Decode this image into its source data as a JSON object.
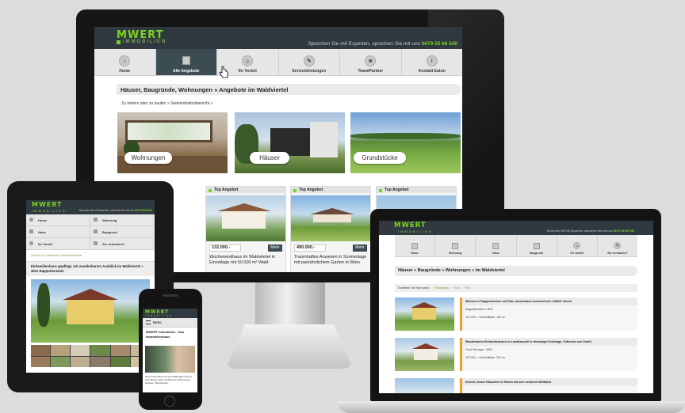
{
  "desktop": {
    "logo": "MWERT",
    "logo_sub": "IMMOBILIEN",
    "tagline_text": "Sprechen Sie mit Experten, sprechen Sie mit uns",
    "phone": "0679 55 66 540",
    "nav": [
      {
        "label": "Home",
        "icon": "home-icon"
      },
      {
        "label": "Alle Angebote",
        "icon": "building-icon",
        "active": true
      },
      {
        "label": "Ihr Vorteil",
        "icon": "smiley-icon"
      },
      {
        "label": "Serviceleistungen",
        "icon": "wrench-icon"
      },
      {
        "label": "Team/Partner",
        "icon": "person-icon"
      },
      {
        "label": "Kontakt Eaton",
        "icon": "info-icon"
      }
    ],
    "page_title": "Häuser, Baugründe, Wohnungen » Angebote im Waldviertel",
    "breadcrumb": "Zu mieten oder zu kaufen » Seiteninhaltsübersicht »",
    "categories": [
      "Wohnungen",
      "Häuser",
      "Grundstücke"
    ],
    "offers": [
      {
        "badge": "Top Angebot",
        "price": "132.000.-",
        "more": "Mehr",
        "text": "Wochenendhaus im Waldviertel in Einzellage mit 50.000 m² Wald"
      },
      {
        "badge": "Top Angebot",
        "price": "490.000.-",
        "more": "Mehr",
        "text": "Traumhaftes Anwesen in Sonnenlage mit parkähnlichem Garten in Wien"
      },
      {
        "badge": "Top Angebot",
        "price": "",
        "more": "",
        "text": ""
      }
    ]
  },
  "tablet": {
    "logo": "MWERT",
    "logo_sub": "IMMOBILIEN",
    "tagline_text": "Sprechen Sie mit Experten, sprechen Sie mit uns",
    "phone": "0679 55 66 540",
    "menu": [
      "Home",
      "Wohnung",
      "Haus",
      "Baugrund",
      "Ihr Vorteil",
      "Sie verkaufen?"
    ],
    "crumbs": [
      "Zurück zur Übersicht",
      "Wohnimmobilie"
    ],
    "title": "Einfamilienhaus gepflegt, mit wunderbarem Ausblick im Waldviertel » 3911 Rappottenstein"
  },
  "phone": {
    "logo": "MWERT",
    "logo_sub": "IMMOBILIEN",
    "menu_label": "Menü",
    "title": "MWERT Immobilien - Das Immobilienhaus",
    "text": "Das Unternehmen ist seit 2006 tätig und auf Vermittlung sowie Verkauf von Wohnungen, Häusern, Baugründen"
  },
  "laptop": {
    "logo": "MWERT",
    "logo_sub": "IMMOBILIEN",
    "tagline_text": "Sprechen Sie mit Experten, sprechen Sie mit uns",
    "phone": "0679 55 66 540",
    "nav": [
      "Home",
      "Wohnung",
      "Haus",
      "Baugrund",
      "Ihr Vorteil",
      "Sie verkaufen?"
    ],
    "title": "Häuser » Baugründe » Wohnungen » im Waldviertel",
    "sort_label": "Sortieren Sie hier nach:",
    "sort_options": [
      "Kaufpreis",
      "Ort",
      "Plz"
    ],
    "listings": [
      {
        "title": "Wohnen in Rappottenstein mit Flair, wunderbarer Aussicht und 1.580m² Grund",
        "place": "Rappottenstein",
        "plz": "3911",
        "price": "147.900.-",
        "area": "Wohnfläche: 130 m²"
      },
      {
        "title": "Wunderbares Einfamilienhaus im Landhausstil in ehemaliger Ruhelage, 5 Minuten von Zwettl",
        "place": "Groß Gerungs",
        "plz": "3920",
        "price": "372.000.-",
        "area": "Wohnfläche: 220 m²"
      },
      {
        "title": "Kleines, feines Häuschen in Rotten mit sehr schönem Weitblick",
        "place": "",
        "plz": "",
        "price": "",
        "area": ""
      }
    ]
  },
  "colors": {
    "accent": "#7ed321",
    "header": "#2f393f",
    "nav_active": "#3b4c52",
    "badge": "#f0a020"
  }
}
